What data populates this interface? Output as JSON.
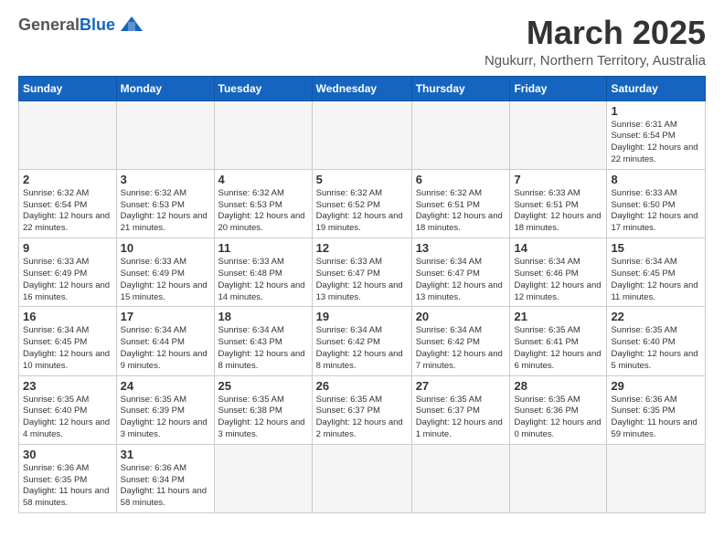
{
  "header": {
    "logo_general": "General",
    "logo_blue": "Blue",
    "main_title": "March 2025",
    "subtitle": "Ngukurr, Northern Territory, Australia"
  },
  "days_of_week": [
    "Sunday",
    "Monday",
    "Tuesday",
    "Wednesday",
    "Thursday",
    "Friday",
    "Saturday"
  ],
  "weeks": [
    [
      {
        "day": "",
        "info": "",
        "empty": true
      },
      {
        "day": "",
        "info": "",
        "empty": true
      },
      {
        "day": "",
        "info": "",
        "empty": true
      },
      {
        "day": "",
        "info": "",
        "empty": true
      },
      {
        "day": "",
        "info": "",
        "empty": true
      },
      {
        "day": "",
        "info": "",
        "empty": true
      },
      {
        "day": "1",
        "info": "Sunrise: 6:31 AM\nSunset: 6:54 PM\nDaylight: 12 hours\nand 22 minutes."
      }
    ],
    [
      {
        "day": "2",
        "info": "Sunrise: 6:32 AM\nSunset: 6:54 PM\nDaylight: 12 hours\nand 22 minutes."
      },
      {
        "day": "3",
        "info": "Sunrise: 6:32 AM\nSunset: 6:53 PM\nDaylight: 12 hours\nand 21 minutes."
      },
      {
        "day": "4",
        "info": "Sunrise: 6:32 AM\nSunset: 6:53 PM\nDaylight: 12 hours\nand 20 minutes."
      },
      {
        "day": "5",
        "info": "Sunrise: 6:32 AM\nSunset: 6:52 PM\nDaylight: 12 hours\nand 19 minutes."
      },
      {
        "day": "6",
        "info": "Sunrise: 6:32 AM\nSunset: 6:51 PM\nDaylight: 12 hours\nand 18 minutes."
      },
      {
        "day": "7",
        "info": "Sunrise: 6:33 AM\nSunset: 6:51 PM\nDaylight: 12 hours\nand 18 minutes."
      },
      {
        "day": "8",
        "info": "Sunrise: 6:33 AM\nSunset: 6:50 PM\nDaylight: 12 hours\nand 17 minutes."
      }
    ],
    [
      {
        "day": "9",
        "info": "Sunrise: 6:33 AM\nSunset: 6:49 PM\nDaylight: 12 hours\nand 16 minutes."
      },
      {
        "day": "10",
        "info": "Sunrise: 6:33 AM\nSunset: 6:49 PM\nDaylight: 12 hours\nand 15 minutes."
      },
      {
        "day": "11",
        "info": "Sunrise: 6:33 AM\nSunset: 6:48 PM\nDaylight: 12 hours\nand 14 minutes."
      },
      {
        "day": "12",
        "info": "Sunrise: 6:33 AM\nSunset: 6:47 PM\nDaylight: 12 hours\nand 13 minutes."
      },
      {
        "day": "13",
        "info": "Sunrise: 6:34 AM\nSunset: 6:47 PM\nDaylight: 12 hours\nand 13 minutes."
      },
      {
        "day": "14",
        "info": "Sunrise: 6:34 AM\nSunset: 6:46 PM\nDaylight: 12 hours\nand 12 minutes."
      },
      {
        "day": "15",
        "info": "Sunrise: 6:34 AM\nSunset: 6:45 PM\nDaylight: 12 hours\nand 11 minutes."
      }
    ],
    [
      {
        "day": "16",
        "info": "Sunrise: 6:34 AM\nSunset: 6:45 PM\nDaylight: 12 hours\nand 10 minutes."
      },
      {
        "day": "17",
        "info": "Sunrise: 6:34 AM\nSunset: 6:44 PM\nDaylight: 12 hours\nand 9 minutes."
      },
      {
        "day": "18",
        "info": "Sunrise: 6:34 AM\nSunset: 6:43 PM\nDaylight: 12 hours\nand 8 minutes."
      },
      {
        "day": "19",
        "info": "Sunrise: 6:34 AM\nSunset: 6:42 PM\nDaylight: 12 hours\nand 8 minutes."
      },
      {
        "day": "20",
        "info": "Sunrise: 6:34 AM\nSunset: 6:42 PM\nDaylight: 12 hours\nand 7 minutes."
      },
      {
        "day": "21",
        "info": "Sunrise: 6:35 AM\nSunset: 6:41 PM\nDaylight: 12 hours\nand 6 minutes."
      },
      {
        "day": "22",
        "info": "Sunrise: 6:35 AM\nSunset: 6:40 PM\nDaylight: 12 hours\nand 5 minutes."
      }
    ],
    [
      {
        "day": "23",
        "info": "Sunrise: 6:35 AM\nSunset: 6:40 PM\nDaylight: 12 hours\nand 4 minutes."
      },
      {
        "day": "24",
        "info": "Sunrise: 6:35 AM\nSunset: 6:39 PM\nDaylight: 12 hours\nand 3 minutes."
      },
      {
        "day": "25",
        "info": "Sunrise: 6:35 AM\nSunset: 6:38 PM\nDaylight: 12 hours\nand 3 minutes."
      },
      {
        "day": "26",
        "info": "Sunrise: 6:35 AM\nSunset: 6:37 PM\nDaylight: 12 hours\nand 2 minutes."
      },
      {
        "day": "27",
        "info": "Sunrise: 6:35 AM\nSunset: 6:37 PM\nDaylight: 12 hours\nand 1 minute."
      },
      {
        "day": "28",
        "info": "Sunrise: 6:35 AM\nSunset: 6:36 PM\nDaylight: 12 hours\nand 0 minutes."
      },
      {
        "day": "29",
        "info": "Sunrise: 6:36 AM\nSunset: 6:35 PM\nDaylight: 11 hours\nand 59 minutes."
      }
    ],
    [
      {
        "day": "30",
        "info": "Sunrise: 6:36 AM\nSunset: 6:35 PM\nDaylight: 11 hours\nand 58 minutes."
      },
      {
        "day": "31",
        "info": "Sunrise: 6:36 AM\nSunset: 6:34 PM\nDaylight: 11 hours\nand 58 minutes."
      },
      {
        "day": "",
        "info": "",
        "empty": true
      },
      {
        "day": "",
        "info": "",
        "empty": true
      },
      {
        "day": "",
        "info": "",
        "empty": true
      },
      {
        "day": "",
        "info": "",
        "empty": true
      },
      {
        "day": "",
        "info": "",
        "empty": true
      }
    ]
  ]
}
